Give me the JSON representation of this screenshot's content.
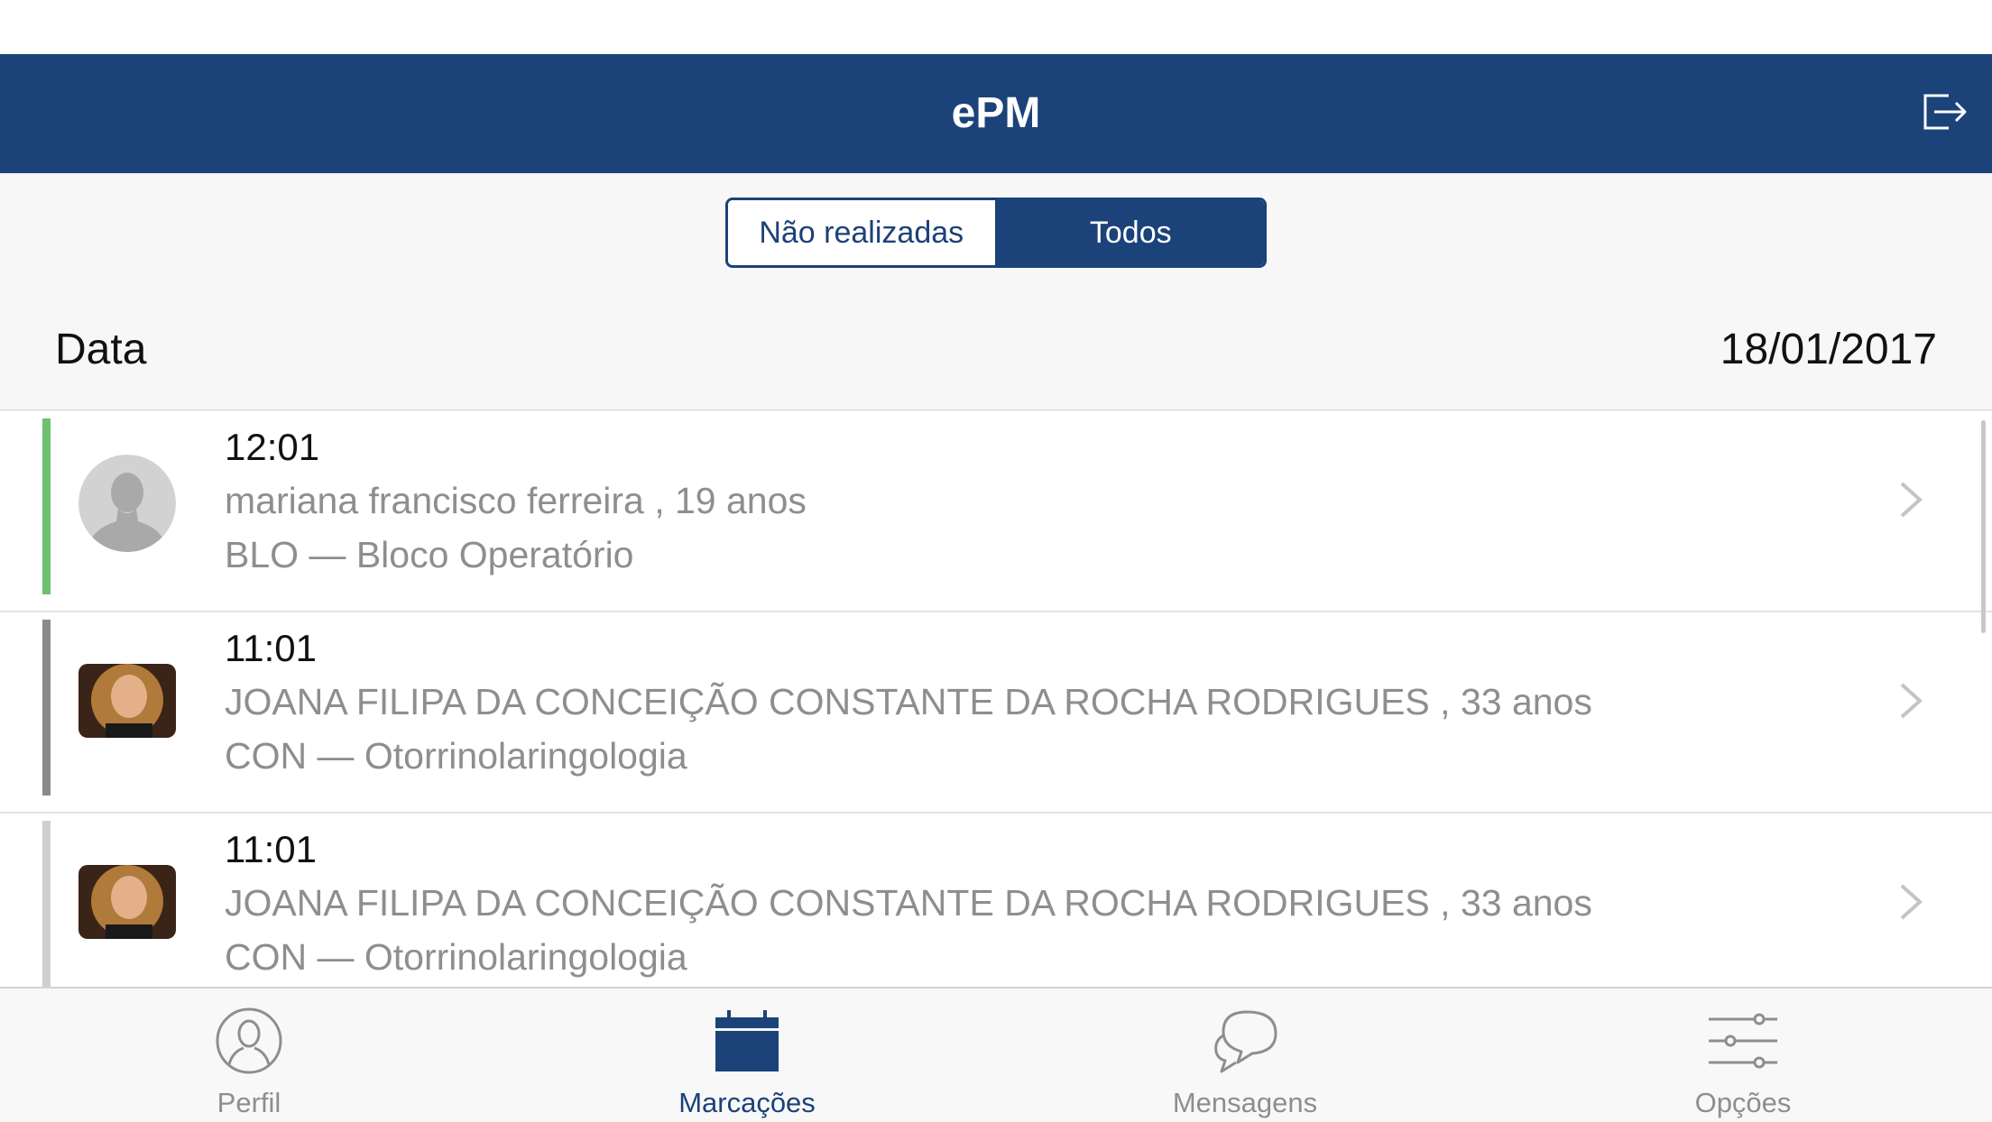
{
  "app": {
    "title": "ePM"
  },
  "colors": {
    "brand": "#1b4279",
    "green": "#6cc070",
    "gray_bar": "#8a8a8a",
    "light_bar": "#cfcfcf"
  },
  "segmented": {
    "options": [
      "Não realizadas",
      "Todos"
    ],
    "selected": "Todos"
  },
  "date": {
    "label": "Data",
    "value": "18/01/2017"
  },
  "appointments": [
    {
      "time": "12:01",
      "patient": "mariana francisco ferreira , 19 anos",
      "department": "BLO — Bloco Operatório",
      "status_color": "#6cc070",
      "avatar": "placeholder-avatar"
    },
    {
      "time": "11:01",
      "patient": "JOANA FILIPA DA CONCEIÇÃO CONSTANTE DA ROCHA RODRIGUES , 33 anos",
      "department": "CON — Otorrinolaringologia",
      "status_color": "#8a8a8a",
      "avatar": "patient-photo"
    },
    {
      "time": "11:01",
      "patient": "JOANA FILIPA DA CONCEIÇÃO CONSTANTE DA ROCHA RODRIGUES , 33 anos",
      "department": "CON — Otorrinolaringologia",
      "status_color": "#cfcfcf",
      "avatar": "patient-photo"
    }
  ],
  "tabs": [
    {
      "label": "Perfil",
      "icon": "person-icon",
      "active": false
    },
    {
      "label": "Marcações",
      "icon": "calendar-icon",
      "active": true
    },
    {
      "label": "Mensagens",
      "icon": "chat-icon",
      "active": false
    },
    {
      "label": "Opções",
      "icon": "sliders-icon",
      "active": false
    }
  ]
}
